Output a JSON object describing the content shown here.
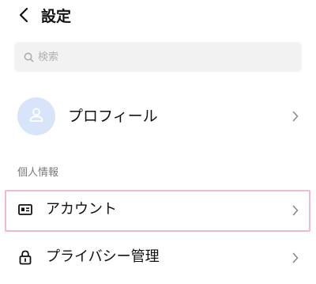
{
  "header": {
    "back_icon": "chevron-left-icon",
    "title": "設定"
  },
  "search": {
    "icon": "search-icon",
    "placeholder": "検索",
    "value": ""
  },
  "profile": {
    "avatar_icon": "user-icon",
    "avatar_color": "#d8e4fa",
    "label": "プロフィール",
    "chevron_icon": "chevron-right-icon"
  },
  "sections": [
    {
      "header": "個人情報",
      "items": [
        {
          "icon": "id-card-icon",
          "label": "アカウント",
          "chevron_icon": "chevron-right-icon",
          "highlighted": true
        },
        {
          "icon": "lock-icon",
          "label": "プライバシー管理",
          "chevron_icon": "chevron-right-icon",
          "highlighted": false
        }
      ]
    }
  ],
  "colors": {
    "highlight_border": "#f2b7d1",
    "search_background": "#f2f2f2",
    "secondary_text": "#7a7a7a"
  }
}
